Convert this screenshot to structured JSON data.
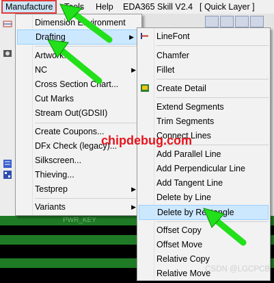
{
  "menubar": {
    "items": [
      "Manufacture",
      "Tools",
      "Help",
      "EDA365 Skill V2.4",
      "[ Quick Layer ]"
    ]
  },
  "main_menu": {
    "items": [
      {
        "label": "Dimension Environment",
        "u": "D"
      },
      {
        "label": "Drafting",
        "u": "D",
        "submenu": true
      },
      {
        "label": "Artwork...",
        "u": "A"
      },
      {
        "label": "NC",
        "u": "N",
        "submenu": true
      },
      {
        "label": "Cross Section Chart...",
        "u": "C"
      },
      {
        "label": "Cut Marks",
        "u": "M"
      },
      {
        "label": "Stream Out(GDSII)",
        "u": "O"
      },
      {
        "label": "Create Coupons...",
        "u": "C"
      },
      {
        "label": "DFx Check (legacy)...",
        "u": "F"
      },
      {
        "label": "Silkscreen...",
        "u": "S"
      },
      {
        "label": "Thieving...",
        "u": "h"
      },
      {
        "label": "Testprep",
        "u": "T",
        "submenu": true
      },
      {
        "label": "Variants",
        "u": "V",
        "submenu": true
      }
    ]
  },
  "sub_menu": {
    "items": [
      {
        "label": "LineFont"
      },
      {
        "label": "Chamfer"
      },
      {
        "label": "Fillet"
      },
      {
        "label": "Create Detail"
      },
      {
        "label": "Extend Segments"
      },
      {
        "label": "Trim Segments"
      },
      {
        "label": "Connect Lines"
      },
      {
        "label": "Add Parallel Line"
      },
      {
        "label": "Add Perpendicular Line"
      },
      {
        "label": "Add Tangent Line"
      },
      {
        "label": "Delete by Line"
      },
      {
        "label": "Delete by Rectangle"
      },
      {
        "label": "Offset Copy"
      },
      {
        "label": "Offset Move"
      },
      {
        "label": "Relative Copy"
      },
      {
        "label": "Relative Move"
      }
    ]
  },
  "watermark": "chipdebug.com",
  "credit": "CSDN @LGCPCB",
  "canvas_label": "PWR_KEY",
  "colors": {
    "highlight": "#cce8ff",
    "arrow": "#22e01a",
    "watermark": "#e8141c",
    "trace": "#1f7a25"
  }
}
